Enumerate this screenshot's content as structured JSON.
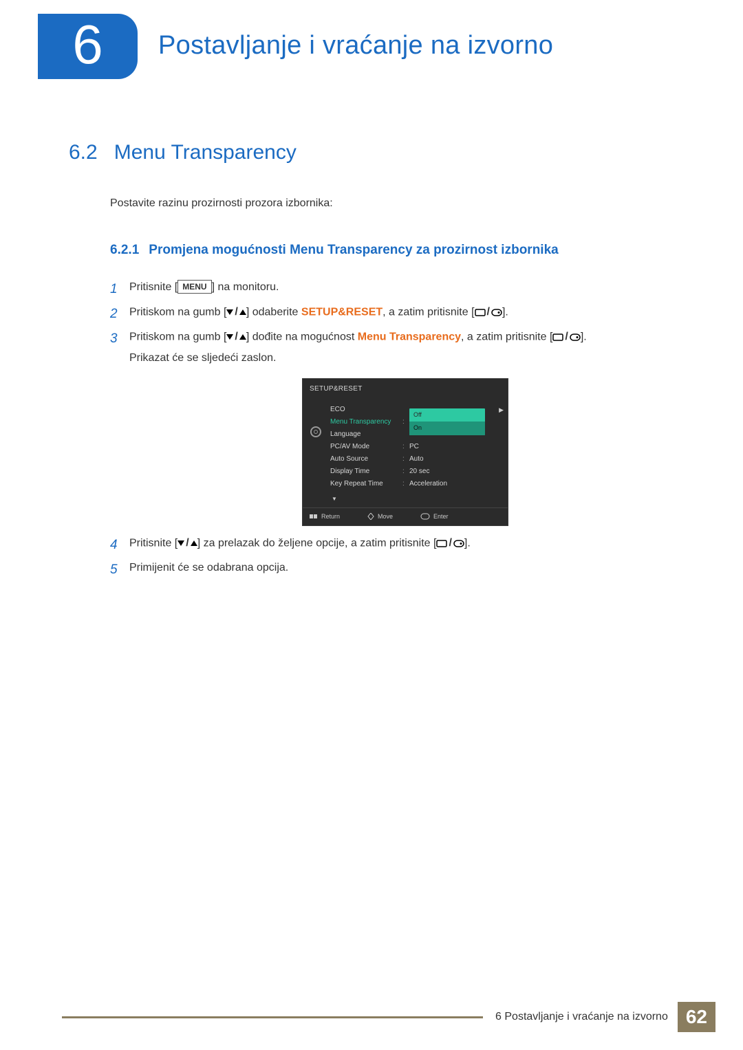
{
  "chapter": {
    "number": "6",
    "title": "Postavljanje i vraćanje na izvorno"
  },
  "section": {
    "number": "6.2",
    "title": "Menu Transparency",
    "intro": "Postavite razinu prozirnosti prozora izbornika:"
  },
  "subsection": {
    "number": "6.2.1",
    "title": "Promjena mogućnosti Menu Transparency za prozirnost izbornika"
  },
  "steps": {
    "s1": {
      "num": "1",
      "a": "Pritisnite [",
      "menu": "MENU",
      "b": "] na monitoru."
    },
    "s2": {
      "num": "2",
      "a": "Pritiskom na gumb [",
      "b": "] odaberite ",
      "kw": "SETUP&RESET",
      "c": ", a zatim pritisnite [",
      "d": "]."
    },
    "s3": {
      "num": "3",
      "a": "Pritiskom na gumb [",
      "b": "] dođite na mogućnost ",
      "kw": "Menu Transparency",
      "c": ", a zatim pritisnite [",
      "d": "].",
      "e": "Prikazat će se sljedeći zaslon."
    },
    "s4": {
      "num": "4",
      "a": "Pritisnite [",
      "b": "] za prelazak do željene opcije, a zatim pritisnite [",
      "c": "]."
    },
    "s5": {
      "num": "5",
      "a": "Primijenit će se odabrana opcija."
    }
  },
  "osd": {
    "title": "SETUP&RESET",
    "rows": [
      {
        "label": "ECO",
        "value": ""
      },
      {
        "label": "Menu Transparency",
        "value": ""
      },
      {
        "label": "Language",
        "value": ""
      },
      {
        "label": "PC/AV Mode",
        "value": "PC"
      },
      {
        "label": "Auto Source",
        "value": "Auto"
      },
      {
        "label": "Display Time",
        "value": "20 sec"
      },
      {
        "label": "Key Repeat Time",
        "value": "Acceleration"
      }
    ],
    "options": {
      "off": "Off",
      "on": "On"
    },
    "footer": {
      "return": "Return",
      "move": "Move",
      "enter": "Enter"
    }
  },
  "footer": {
    "text": "6 Postavljanje i vraćanje na izvorno",
    "page": "62"
  }
}
